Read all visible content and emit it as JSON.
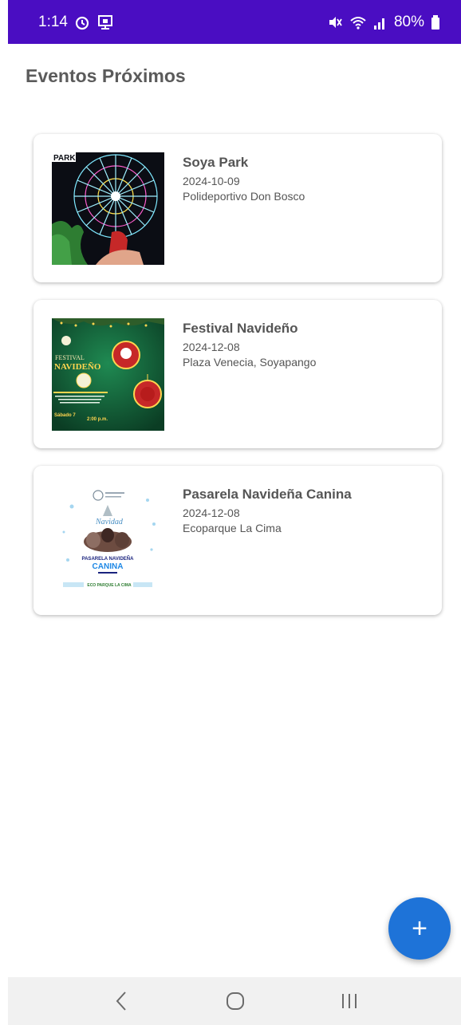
{
  "status_bar": {
    "time": "1:14",
    "battery": "80%",
    "left_icons": [
      "alarm-icon",
      "cast-icon"
    ],
    "right_icons": [
      "mute-icon",
      "wifi-icon",
      "signal-icon",
      "battery-icon"
    ],
    "background": "#4a0dc2"
  },
  "page": {
    "title": "Eventos Próximos"
  },
  "events": [
    {
      "title": "Soya Park",
      "date": "2024-10-09",
      "place": "Polideportivo Don Bosco",
      "thumbnail_text": "PARK"
    },
    {
      "title": "Festival Navideño",
      "date": "2024-12-08",
      "place": "Plaza Venecia, Soyapango",
      "thumbnail_text": [
        "FESTIVAL",
        "NAVIDEÑO",
        "Sábado 7",
        "2:00 p.m."
      ]
    },
    {
      "title": "Pasarela Navideña Canina",
      "date": "2024-12-08",
      "place": "Ecoparque La Cima",
      "thumbnail_text": [
        "Navidad",
        "PASARELA NAVIDEÑA",
        "CANINA",
        "ECO PARQUE LA CIMA"
      ]
    }
  ],
  "fab": {
    "label": "+",
    "color": "#1e73d8"
  },
  "nav_bar": {
    "buttons": [
      "back-icon",
      "home-icon",
      "recents-icon"
    ]
  }
}
